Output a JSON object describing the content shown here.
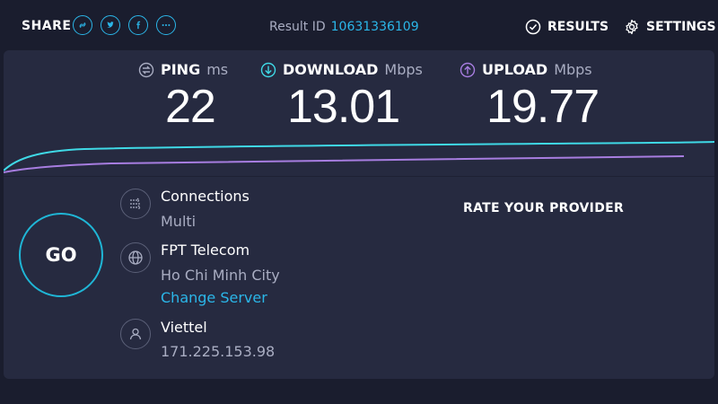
{
  "header": {
    "share_label": "SHARE",
    "result_id_label": "Result ID",
    "result_id_value": "10631336109",
    "results_label": "RESULTS",
    "settings_label": "SETTINGS",
    "share_icons": [
      "link-icon",
      "twitter-icon",
      "facebook-icon",
      "more-icon"
    ]
  },
  "metrics": {
    "ping": {
      "label": "PING",
      "unit": "ms",
      "value": "22"
    },
    "download": {
      "label": "DOWNLOAD",
      "unit": "Mbps",
      "value": "13.01"
    },
    "upload": {
      "label": "UPLOAD",
      "unit": "Mbps",
      "value": "19.77"
    }
  },
  "go_label": "GO",
  "connections": {
    "title": "Connections",
    "value": "Multi"
  },
  "server": {
    "name": "FPT Telecom",
    "location": "Ho Chi Minh City",
    "change_label": "Change Server"
  },
  "provider": {
    "name": "Viettel",
    "ip": "171.225.153.98"
  },
  "rate_label": "RATE YOUR PROVIDER",
  "colors": {
    "background": "#1a1d2e",
    "panel": "#262a40",
    "accent": "#2bb6e8",
    "download": "#3fd9e6",
    "upload": "#a77de0",
    "muted": "#a9adc2"
  }
}
